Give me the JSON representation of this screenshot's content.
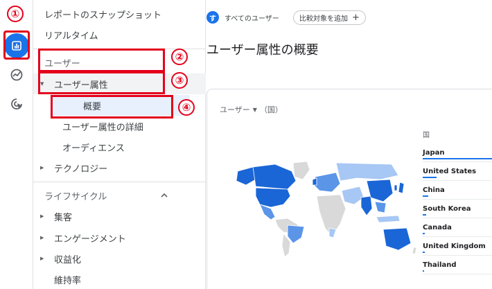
{
  "rail": {
    "items": [
      {
        "icon": "bar-chart-icon",
        "active": true
      },
      {
        "icon": "explore-icon",
        "active": false
      },
      {
        "icon": "advertising-icon",
        "active": false
      }
    ]
  },
  "callouts": [
    "①",
    "②",
    "③",
    "④"
  ],
  "sidebar": {
    "snapshot": "レポートのスナップショット",
    "realtime": "リアルタイム",
    "user_section": "ユーザー",
    "demographics": "ユーザー属性",
    "overview": "概要",
    "demographics_detail": "ユーザー属性の詳細",
    "audiences": "オーディエンス",
    "technology": "テクノロジー",
    "lifecycle_section": "ライフサイクル",
    "acquisition": "集客",
    "engagement": "エンゲージメント",
    "monetization": "収益化",
    "retention": "維持率"
  },
  "filter": {
    "user_badge": "す",
    "user_label": "すべてのユーザー",
    "compare_label": "比較対象を追加",
    "compare_icon": "+"
  },
  "page": {
    "title": "ユーザー属性の概要"
  },
  "card": {
    "dimension": "ユーザー",
    "dimension_suffix": "（国）",
    "legend_header": "国",
    "countries": [
      {
        "name": "Japan",
        "share": 1.0
      },
      {
        "name": "United States",
        "share": 0.2
      },
      {
        "name": "China",
        "share": 0.08
      },
      {
        "name": "South Korea",
        "share": 0.05
      },
      {
        "name": "Canada",
        "share": 0.03
      },
      {
        "name": "United Kingdom",
        "share": 0.03
      },
      {
        "name": "Thailand",
        "share": 0.02
      }
    ]
  },
  "colors": {
    "accent": "#1a73e8",
    "callout": "#e3001b",
    "selected_bg": "#e8f0fe",
    "map_dark": "#1a66d6",
    "map_mid": "#5a95e8",
    "map_light": "#a7c7f5",
    "map_none": "#d9d9d9"
  }
}
